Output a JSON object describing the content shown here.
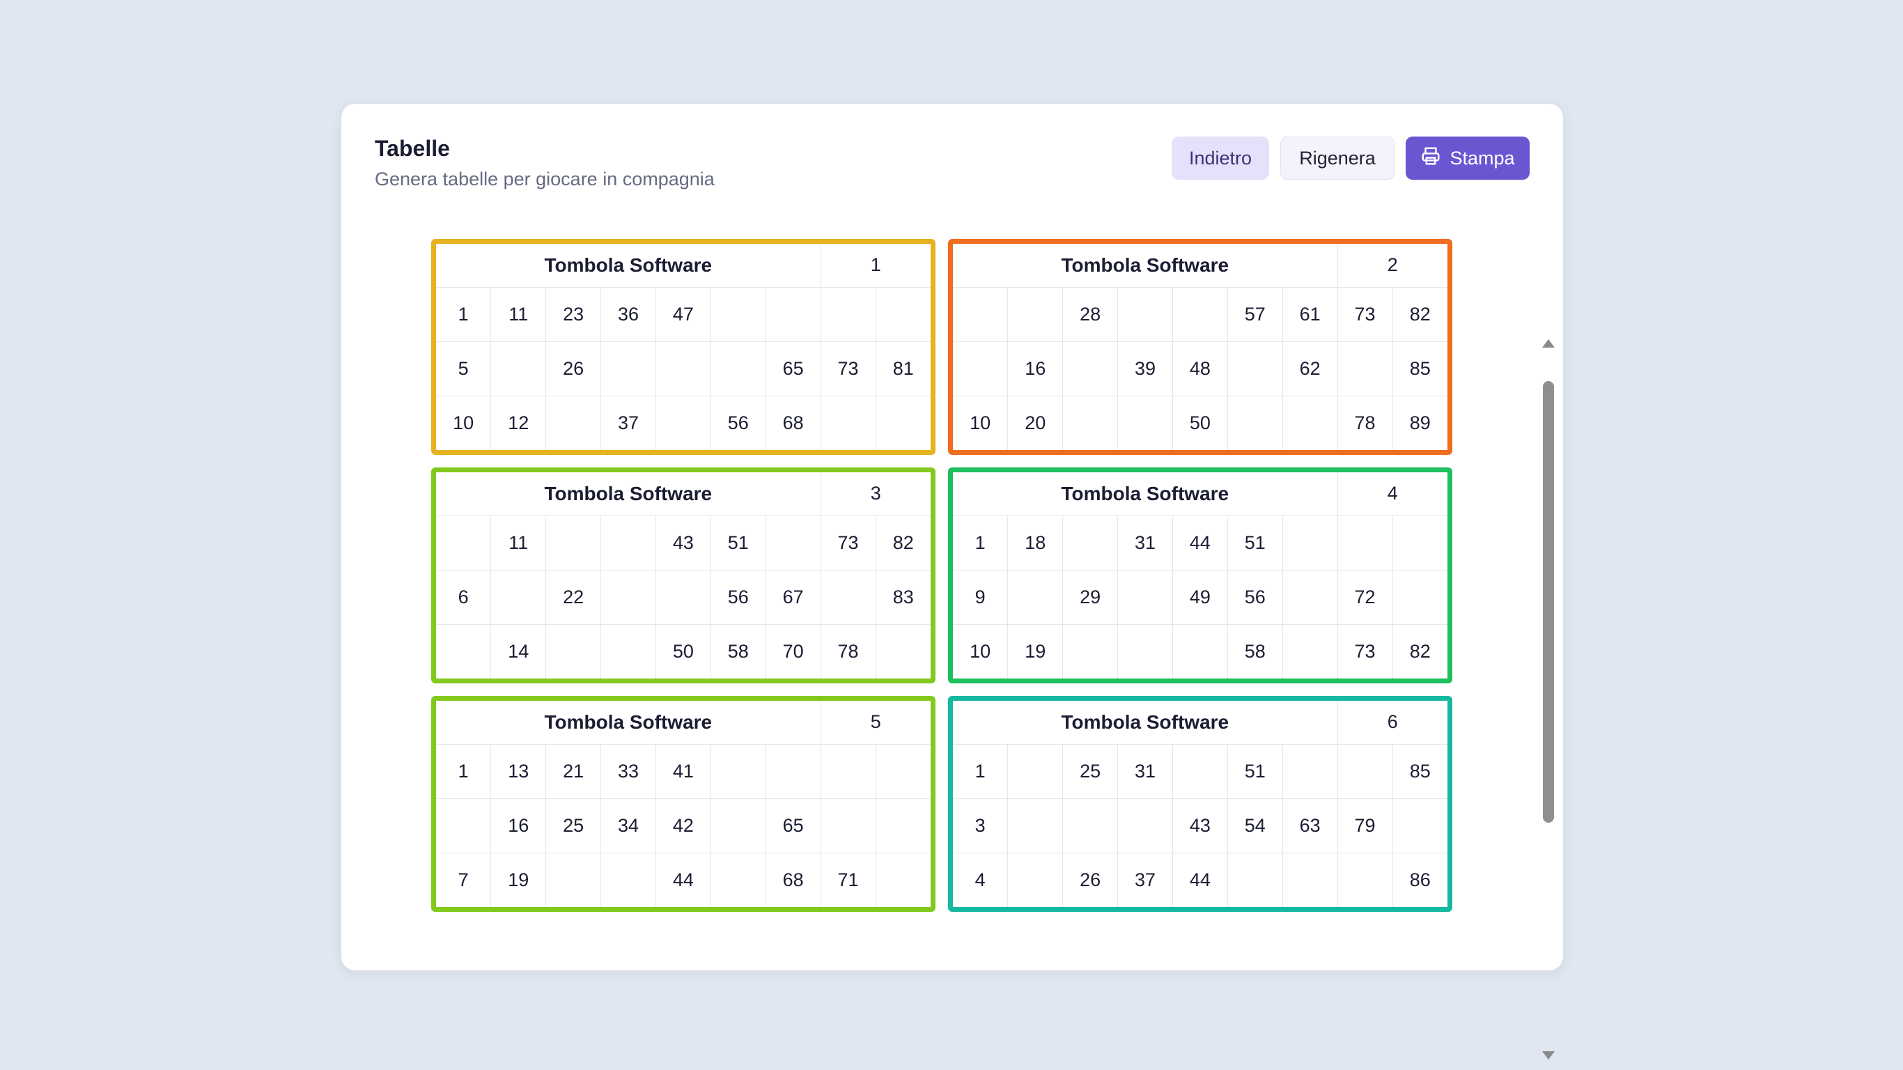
{
  "header": {
    "title": "Tabelle",
    "subtitle": "Genera tabelle per giocare in compagnia"
  },
  "actions": {
    "back_label": "Indietro",
    "regen_label": "Rigenera",
    "print_label": "Stampa",
    "print_icon": "printer-icon"
  },
  "tickets": [
    {
      "name": "Tombola Software",
      "number": "1",
      "border_color": "#e6b21f",
      "rows": [
        [
          "1",
          "11",
          "23",
          "36",
          "47",
          "",
          "",
          "",
          ""
        ],
        [
          "5",
          "",
          "26",
          "",
          "",
          "",
          "65",
          "73",
          "81"
        ],
        [
          "10",
          "12",
          "",
          "37",
          "",
          "56",
          "68",
          "",
          ""
        ]
      ]
    },
    {
      "name": "Tombola Software",
      "number": "2",
      "border_color": "#ef6d1e",
      "rows": [
        [
          "",
          "",
          "28",
          "",
          "",
          "57",
          "61",
          "73",
          "82"
        ],
        [
          "",
          "16",
          "",
          "39",
          "48",
          "",
          "62",
          "",
          "85"
        ],
        [
          "10",
          "20",
          "",
          "",
          "50",
          "",
          "",
          "78",
          "89"
        ]
      ]
    },
    {
      "name": "Tombola Software",
      "number": "3",
      "border_color": "#82c91e",
      "rows": [
        [
          "",
          "11",
          "",
          "",
          "43",
          "51",
          "",
          "73",
          "82"
        ],
        [
          "6",
          "",
          "22",
          "",
          "",
          "56",
          "67",
          "",
          "83"
        ],
        [
          "",
          "14",
          "",
          "",
          "50",
          "58",
          "70",
          "78",
          ""
        ]
      ]
    },
    {
      "name": "Tombola Software",
      "number": "4",
      "border_color": "#1fbf5c",
      "rows": [
        [
          "1",
          "18",
          "",
          "31",
          "44",
          "51",
          "",
          "",
          ""
        ],
        [
          "9",
          "",
          "29",
          "",
          "49",
          "56",
          "",
          "72",
          ""
        ],
        [
          "10",
          "19",
          "",
          "",
          "",
          "58",
          "",
          "73",
          "82"
        ]
      ]
    },
    {
      "name": "Tombola Software",
      "number": "5",
      "border_color": "#82c91e",
      "rows": [
        [
          "1",
          "13",
          "21",
          "33",
          "41",
          "",
          "",
          "",
          ""
        ],
        [
          "",
          "16",
          "25",
          "34",
          "42",
          "",
          "65",
          "",
          ""
        ],
        [
          "7",
          "19",
          "",
          "",
          "44",
          "",
          "68",
          "71",
          ""
        ]
      ]
    },
    {
      "name": "Tombola Software",
      "number": "6",
      "border_color": "#17b8a2",
      "rows": [
        [
          "1",
          "",
          "25",
          "31",
          "",
          "51",
          "",
          "",
          "85"
        ],
        [
          "3",
          "",
          "",
          "",
          "43",
          "54",
          "63",
          "79",
          ""
        ],
        [
          "4",
          "",
          "26",
          "37",
          "44",
          "",
          "",
          "",
          "86"
        ]
      ]
    }
  ]
}
